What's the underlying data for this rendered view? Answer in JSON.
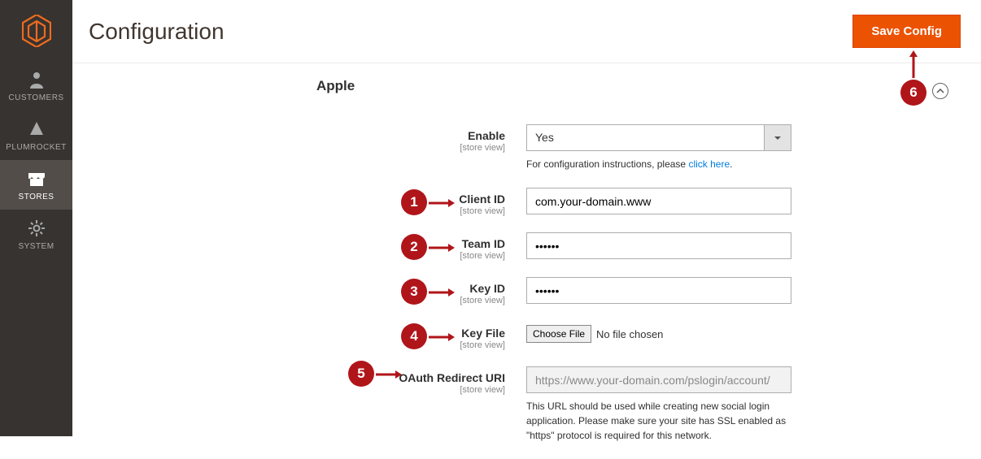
{
  "sidebar": {
    "items": [
      {
        "label": "CUSTOMERS"
      },
      {
        "label": "PLUMROCKET"
      },
      {
        "label": "STORES"
      },
      {
        "label": "SYSTEM"
      }
    ]
  },
  "header": {
    "title": "Configuration",
    "save_label": "Save Config"
  },
  "section": {
    "title": "Apple"
  },
  "scope_label": "[store view]",
  "fields": {
    "enable": {
      "label": "Enable",
      "value": "Yes",
      "note_prefix": "For configuration instructions, please ",
      "note_link": "click here",
      "note_suffix": "."
    },
    "client_id": {
      "label": "Client ID",
      "value": "com.your-domain.www"
    },
    "team_id": {
      "label": "Team ID",
      "value": "••••••"
    },
    "key_id": {
      "label": "Key ID",
      "value": "••••••"
    },
    "key_file": {
      "label": "Key File",
      "button": "Choose File",
      "status": "No file chosen"
    },
    "redirect": {
      "label": "OAuth Redirect URI",
      "value": "https://www.your-domain.com/pslogin/account/",
      "note": "This URL should be used while creating new social login application. Please make sure your site has SSL enabled as \"https\" protocol is required for this network."
    }
  },
  "markers": {
    "m1": "1",
    "m2": "2",
    "m3": "3",
    "m4": "4",
    "m5": "5",
    "m6": "6"
  }
}
